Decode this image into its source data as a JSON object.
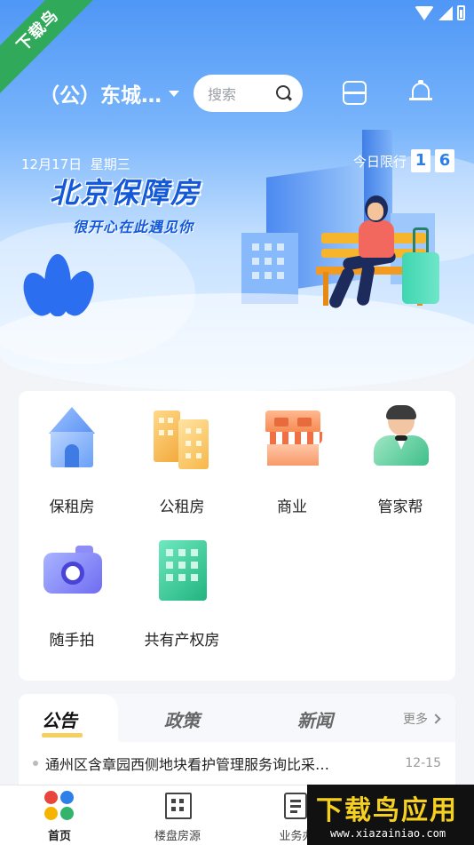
{
  "watermark": {
    "ribbon": "下载鸟",
    "brand": "下载鸟应用",
    "url": "www.xiazainiao.com"
  },
  "header": {
    "district": "（公）东城…",
    "search_placeholder": "搜索"
  },
  "banner": {
    "date": "12月17日",
    "weekday": "星期三",
    "limit_label": "今日限行",
    "limit_numbers": [
      "1",
      "6"
    ],
    "title": "北京保障房",
    "subtitle": "很开心在此遇见你"
  },
  "services": [
    {
      "label": "保租房",
      "icon": "house-icon"
    },
    {
      "label": "公租房",
      "icon": "buildings-icon"
    },
    {
      "label": "商业",
      "icon": "shop-icon"
    },
    {
      "label": "管家帮",
      "icon": "butler-icon"
    },
    {
      "label": "随手拍",
      "icon": "camera-icon"
    },
    {
      "label": "共有产权房",
      "icon": "green-building-icon"
    }
  ],
  "news": {
    "tabs": [
      "公告",
      "政策",
      "新闻"
    ],
    "active_tab": "公告",
    "more": "更多",
    "items": [
      {
        "title": "通州区含章园西侧地块看护管理服务询比采…",
        "date": "12-15"
      }
    ]
  },
  "bottom_nav": [
    {
      "label": "首页",
      "icon": "home-logo-icon",
      "active": true
    },
    {
      "label": "楼盘房源",
      "icon": "building-icon",
      "active": false
    },
    {
      "label": "业务办",
      "icon": "document-icon",
      "active": false
    }
  ],
  "colors": {
    "primary_blue": "#1459d8",
    "banner_top": "#4f97f6",
    "ribbon_green": "#31a95a",
    "tab_highlight": "#f7c640"
  }
}
